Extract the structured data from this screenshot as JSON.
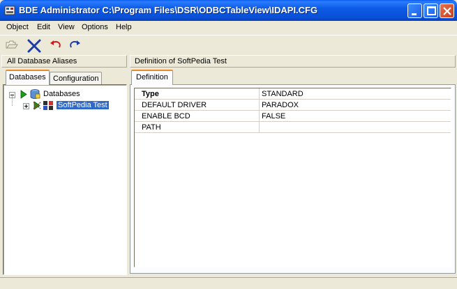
{
  "window": {
    "title": "BDE Administrator  C:\\Program Files\\DSR\\ODBCTableView\\IDAPI.CFG"
  },
  "menu": {
    "items": [
      "Object",
      "Edit",
      "View",
      "Options",
      "Help"
    ]
  },
  "toolbar": {
    "buttons": [
      "open-folder-icon",
      "delete-icon",
      "undo-icon",
      "redo-icon"
    ]
  },
  "left_panel": {
    "header": "All Database Aliases",
    "tabs": [
      "Databases",
      "Configuration"
    ],
    "active_tab": "Databases",
    "tree": {
      "root_label": "Databases",
      "children": [
        {
          "label": "SoftPedia Test",
          "selected": true
        }
      ]
    }
  },
  "right_panel": {
    "header": "Definition of SoftPedia Test",
    "tabs": [
      "Definition"
    ],
    "rows": [
      {
        "key": "Type",
        "value": "STANDARD",
        "bold": true
      },
      {
        "key": "DEFAULT DRIVER",
        "value": "PARADOX",
        "bold": false
      },
      {
        "key": "ENABLE BCD",
        "value": "FALSE",
        "bold": false
      },
      {
        "key": "PATH",
        "value": "",
        "bold": false
      }
    ]
  },
  "colors": {
    "title_bar": "#0A4FD6",
    "selection": "#316AC5",
    "window_bg": "#ECE9D8"
  }
}
